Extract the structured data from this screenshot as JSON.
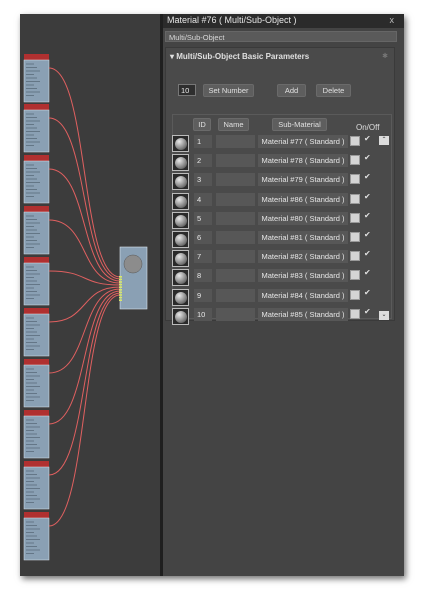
{
  "window": {
    "title": "Material #76  ( Multi/Sub-Object )",
    "close": "x"
  },
  "material_type": "Multi/Sub-Object",
  "rollout": {
    "title": "Multi/Sub-Object Basic Parameters"
  },
  "controls": {
    "count": "10",
    "set_number": "Set Number",
    "add": "Add",
    "delete": "Delete"
  },
  "headers": {
    "id": "ID",
    "name": "Name",
    "sub_material": "Sub-Material",
    "on_off": "On/Off"
  },
  "rows": [
    {
      "id": "1",
      "material": "Material #77  ( Standard )",
      "on": true
    },
    {
      "id": "2",
      "material": "Material #78  ( Standard )",
      "on": true
    },
    {
      "id": "3",
      "material": "Material #79  ( Standard )",
      "on": true
    },
    {
      "id": "4",
      "material": "Material #86  ( Standard )",
      "on": true
    },
    {
      "id": "5",
      "material": "Material #80  ( Standard )",
      "on": true
    },
    {
      "id": "6",
      "material": "Material #81  ( Standard )",
      "on": true
    },
    {
      "id": "7",
      "material": "Material #82  ( Standard )",
      "on": true
    },
    {
      "id": "8",
      "material": "Material #83  ( Standard )",
      "on": true
    },
    {
      "id": "9",
      "material": "Material #84  ( Standard )",
      "on": true
    },
    {
      "id": "10",
      "material": "Material #85  ( Standard )",
      "on": true
    }
  ],
  "colors": {
    "wire": "#e06060",
    "node_header": "#b03030",
    "node_body": "#8aa0b4"
  }
}
